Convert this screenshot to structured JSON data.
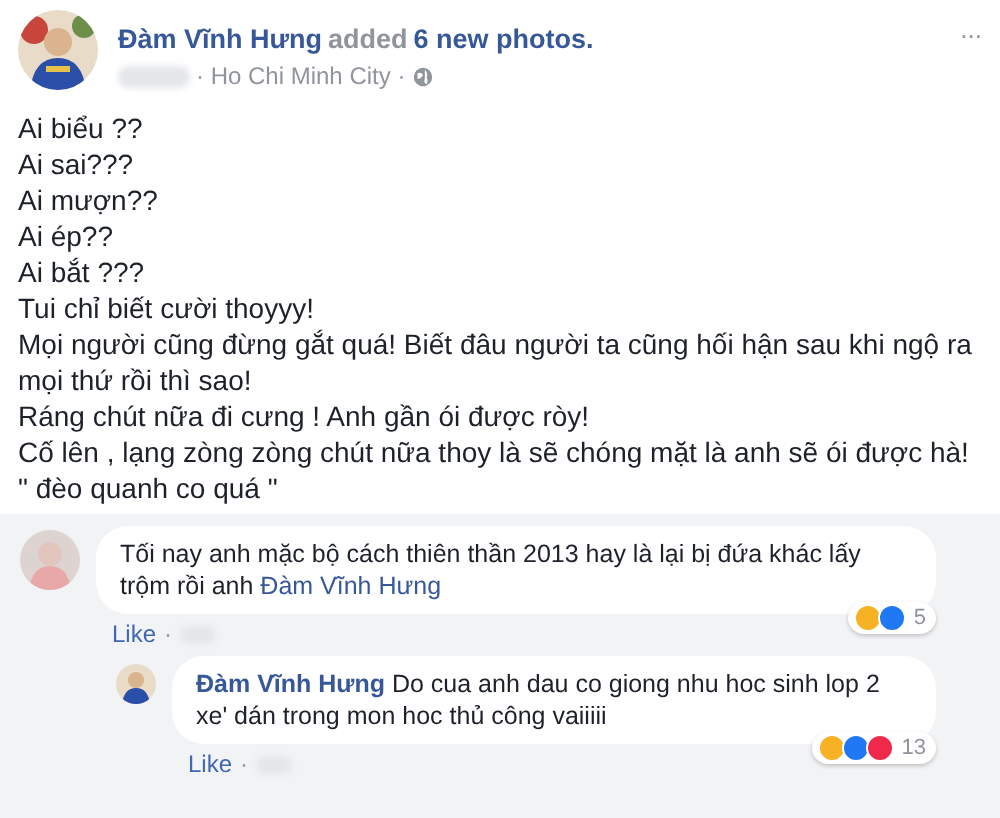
{
  "post": {
    "author": "Đàm Vĩnh Hưng",
    "action": "added",
    "action_link": "6 new photos.",
    "location": "· Ho Chi Minh City ·",
    "more": "...",
    "lines": [
      "Ai biểu ??",
      "Ai sai???",
      "Ai mượn??",
      "Ai ép??",
      "Ai bắt ???",
      "Tui chỉ biết cười thoyyy!",
      "Mọi người cũng đừng gắt quá! Biết đâu người ta cũng hối hận sau khi ngộ ra mọi thứ rồi thì sao!",
      "Ráng chút nữa đi cưng ! Anh gần ói được ròy!",
      "Cố lên , lạng zòng zòng chút nữa thoy là sẽ chóng mặt là anh sẽ ói được hà!",
      "\" đèo quanh co quá \""
    ]
  },
  "comments": [
    {
      "kind": "comment",
      "text": "Tối nay anh mặc bộ cách thiên thần 2013 hay là lại bị đứa khác lấy trộm rồi anh ",
      "mention": "Đàm Vĩnh Hưng",
      "like": "Like",
      "sep": "·",
      "reactions": [
        {
          "color": "#f7b125"
        },
        {
          "color": "#2078f4"
        }
      ],
      "count": "5"
    },
    {
      "kind": "reply",
      "author": "Đàm Vĩnh Hưng",
      "text": "Do cua anh dau co giong nhu hoc sinh lop 2 xe' dán trong mon hoc thủ công vaiiiii",
      "like": "Like",
      "sep": "·",
      "reactions": [
        {
          "color": "#f7b125"
        },
        {
          "color": "#2078f4"
        },
        {
          "color": "#f0284a"
        }
      ],
      "count": "13"
    }
  ]
}
